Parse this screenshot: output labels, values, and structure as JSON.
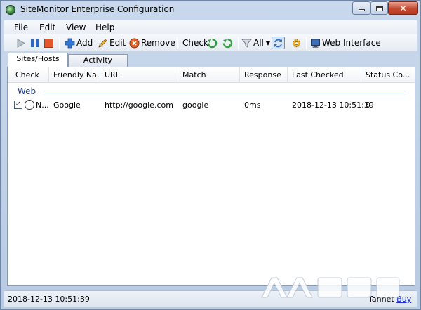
{
  "window": {
    "title": "SiteMonitor Enterprise Configuration"
  },
  "menu": [
    "File",
    "Edit",
    "View",
    "Help"
  ],
  "toolbar": {
    "add_label": "Add",
    "edit_label": "Edit",
    "remove_label": "Remove",
    "check_label": "Check",
    "filter_label": "All",
    "web_interface_label": "Web Interface"
  },
  "tabs": [
    "Sites/Hosts",
    "Activity"
  ],
  "table": {
    "columns": [
      "Check",
      "Friendly Na...",
      "URL",
      "Match",
      "Response",
      "Last Checked",
      "Status Co..."
    ],
    "group": "Web",
    "rows": [
      {
        "checked": true,
        "check_text": "N...",
        "friendly_name": "Google",
        "url": "http://google.com",
        "match": "google",
        "response": "0ms",
        "last_checked": "2018-12-13 10:51:39",
        "status_code": "0"
      }
    ]
  },
  "statusbar": {
    "time": "2018-12-13 10:51:39",
    "vendor": "Tannet",
    "buy_label": "Buy"
  },
  "colors": {
    "window_frame": "#b8cbe3",
    "group_text": "#1e3f9c",
    "link": "#1b2fd0",
    "close_button": "#c34a32"
  }
}
